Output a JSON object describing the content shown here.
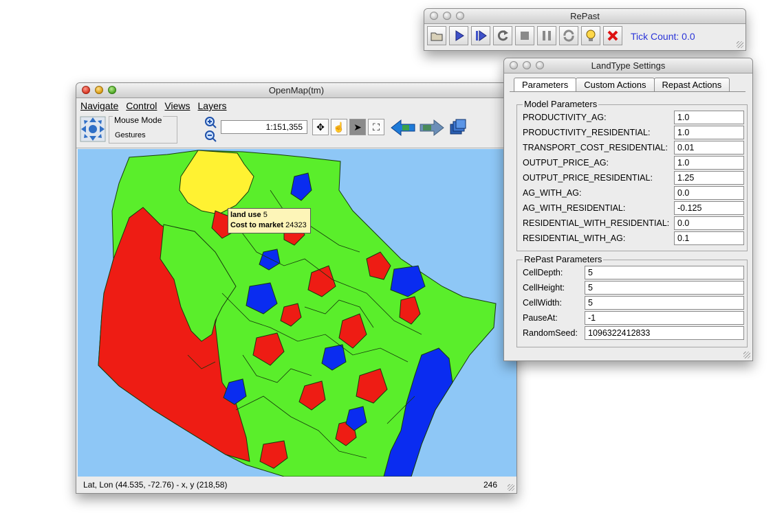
{
  "openmap": {
    "title": "OpenMap(tm)",
    "menus": [
      "Navigate",
      "Control",
      "Views",
      "Layers"
    ],
    "mouse_mode_label": "Mouse Mode",
    "mouse_mode_value": "Gestures",
    "scale": "1:151,355",
    "tooltip": {
      "land_use_label": "land use",
      "land_use_value": "5",
      "cost_label": "Cost to market",
      "cost_value": "24323"
    },
    "status": {
      "coords": "Lat, Lon (44.535, -72.76) - x, y (218,58)",
      "number": "246"
    },
    "colors": {
      "water": "#8ec7f6",
      "green": "#5aee2b",
      "red": "#ee1c14",
      "blue": "#0a2cf0",
      "yellow": "#fff232"
    }
  },
  "repast": {
    "title": "RePast",
    "buttons": [
      "open-icon",
      "play-icon",
      "step-icon",
      "reload-icon",
      "stop-icon",
      "pause-icon",
      "refresh-icon",
      "bulb-icon",
      "exit-icon"
    ],
    "tick_count": "Tick Count: 0.0"
  },
  "settings": {
    "title": "LandType Settings",
    "tabs": [
      "Parameters",
      "Custom Actions",
      "Repast Actions"
    ],
    "model_group": "Model Parameters",
    "model_params": [
      {
        "label": "PRODUCTIVITY_AG:",
        "value": "1.0"
      },
      {
        "label": "PRODUCTIVITY_RESIDENTIAL:",
        "value": "1.0"
      },
      {
        "label": "TRANSPORT_COST_RESIDENTIAL:",
        "value": "0.01"
      },
      {
        "label": "OUTPUT_PRICE_AG:",
        "value": "1.0"
      },
      {
        "label": "OUTPUT_PRICE_RESIDENTIAL:",
        "value": "1.25"
      },
      {
        "label": "AG_WITH_AG:",
        "value": "0.0"
      },
      {
        "label": "AG_WITH_RESIDENTIAL:",
        "value": "-0.125"
      },
      {
        "label": "RESIDENTIAL_WITH_RESIDENTIAL:",
        "value": "0.0"
      },
      {
        "label": "RESIDENTIAL_WITH_AG:",
        "value": "0.1"
      }
    ],
    "repast_group": "RePast Parameters",
    "repast_params": [
      {
        "label": "CellDepth:",
        "value": "5"
      },
      {
        "label": "CellHeight:",
        "value": "5"
      },
      {
        "label": "CellWidth:",
        "value": "5"
      },
      {
        "label": "PauseAt:",
        "value": "-1"
      },
      {
        "label": "RandomSeed:",
        "value": "1096322412833"
      }
    ]
  }
}
